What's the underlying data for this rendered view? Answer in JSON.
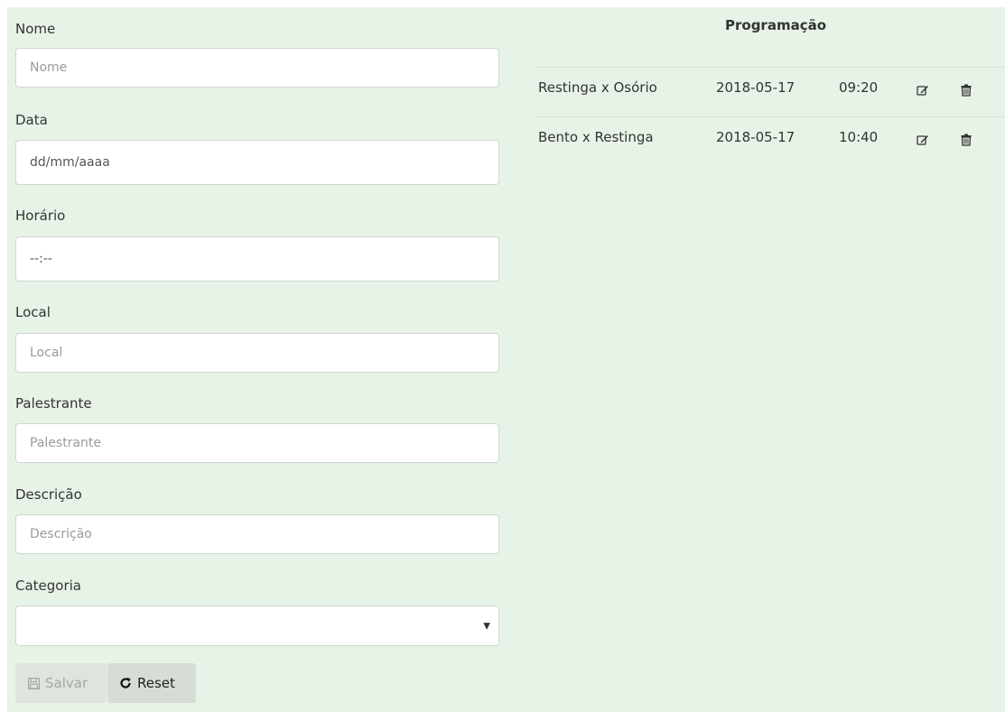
{
  "form": {
    "fields": [
      {
        "label": "Nome",
        "placeholder": "Nome",
        "value": ""
      },
      {
        "label": "Data",
        "placeholder": "",
        "value": "dd/mm/aaaa"
      },
      {
        "label": "Horário",
        "placeholder": "",
        "value": "--:--"
      },
      {
        "label": "Local",
        "placeholder": "Local",
        "value": ""
      },
      {
        "label": "Palestrante",
        "placeholder": "Palestrante",
        "value": ""
      },
      {
        "label": "Descrição",
        "placeholder": "Descrição",
        "value": ""
      },
      {
        "label": "Categoria",
        "placeholder": "",
        "value": ""
      }
    ],
    "save_label": "Salvar",
    "reset_label": "Reset"
  },
  "schedule": {
    "title": "Programação",
    "rows": [
      {
        "name": "Restinga x Osório",
        "date": "2018-05-17",
        "time": "09:20"
      },
      {
        "name": "Bento x Restinga",
        "date": "2018-05-17",
        "time": "10:40"
      }
    ]
  },
  "icons": {
    "save": "floppy-disk-icon",
    "reset": "refresh-icon",
    "edit": "edit-icon",
    "delete": "trash-icon"
  },
  "colors": {
    "background": "#e8f3e7",
    "save_button": "#dfe5de",
    "reset_button": "#d7dcd6"
  }
}
